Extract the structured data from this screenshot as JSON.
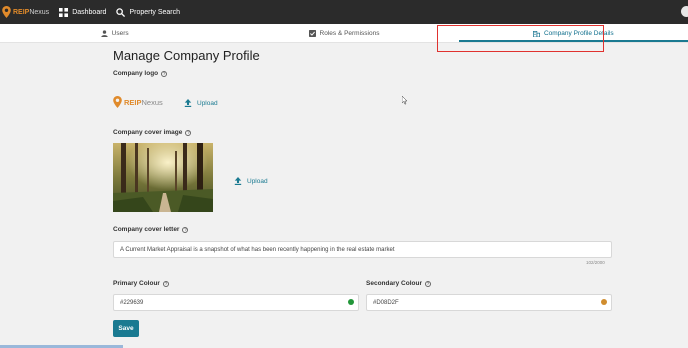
{
  "brand": {
    "reip": "REIP",
    "nexus": "Nexus"
  },
  "topnav": [
    {
      "label": "Dashboard",
      "icon": "grid-icon"
    },
    {
      "label": "Property Search",
      "icon": "search-icon"
    }
  ],
  "tabs": [
    {
      "label": "Users",
      "icon": "user-icon"
    },
    {
      "label": "Roles & Permissions",
      "icon": "checkbox-icon"
    },
    {
      "label": "Company Profile Details",
      "icon": "building-icon",
      "active": true
    }
  ],
  "page": {
    "title": "Manage Company Profile",
    "logo_label": "Company logo",
    "logo_upload": "Upload",
    "cover_image_label": "Company cover image",
    "cover_upload": "Upload",
    "cover_letter_label": "Company cover letter",
    "cover_letter_value": "A Current Market Appraisal is a snapshot of what has been recently happening in the real estate market",
    "cover_letter_count": "102/2000",
    "primary_label": "Primary Colour",
    "primary_value": "#229639",
    "secondary_label": "Secondary Colour",
    "secondary_value": "#D08D2F",
    "save_label": "Save"
  },
  "colors": {
    "accent": "#1a7a91",
    "brand_orange": "#e08a2b",
    "topbar": "#2b2b2b",
    "primary": "#229639",
    "secondary": "#D08D2F",
    "highlight": "#e0322f"
  }
}
